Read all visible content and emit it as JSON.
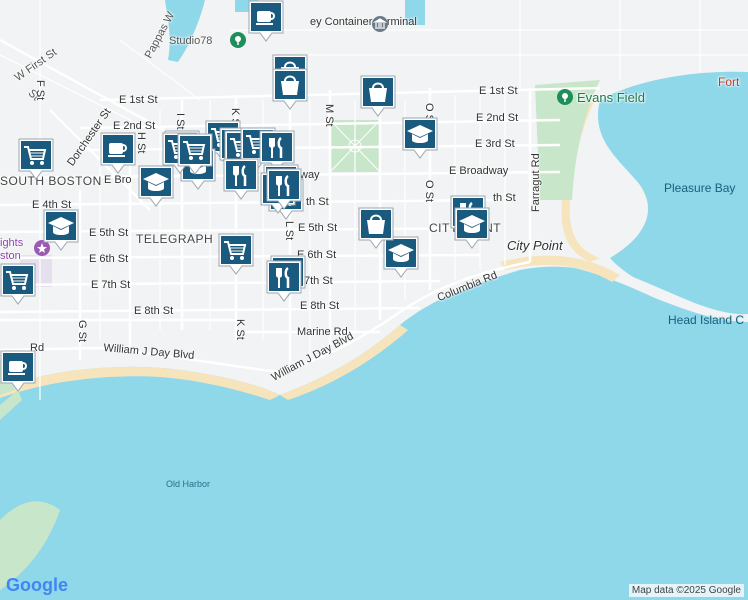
{
  "map": {
    "labels": {
      "w_first_st": "W First St",
      "pappas": "Pappas W",
      "container_terminal": "ey Container Terminal",
      "studio78": "Studio78",
      "fort": "Fort",
      "e_1st_st": "E 1st St",
      "e_1st_st_r": "E 1st St",
      "evans_field": "Evans Field",
      "e_2nd_st": "E 2nd St",
      "e_2nd_st_r": "E 2nd St",
      "e_3rd_st": "E 3rd St",
      "dorchester_st": "Dorchester St",
      "south_boston": "SOUTH BOSTON",
      "e_bro": "E Bro",
      "broadway_mid": "way",
      "e_broadway": "E Broadway",
      "pleasure_bay": "Pleasure Bay",
      "e_4th_st": "E 4th St",
      "th_st_mid": "th St",
      "th_st_r": "th St",
      "e_5th_st": "E 5th St",
      "e_5th_st_mid": "E 5th St",
      "telegraph": "TELEGRAPH",
      "city_point_hood": "CITY POINT",
      "city_point": "City Point",
      "ights": "ights",
      "ston": "ston",
      "e_6th_st": "E 6th St",
      "e_6th_st_mid": "E 6th St",
      "e_7th_st": "E 7th St",
      "th_7_mid": "7th St",
      "e_8th_st": "E 8th St",
      "e_8th_st_mid": "E 8th St",
      "columbia_rd": "Columbia Rd",
      "head_island": "Head Island C",
      "marine_rd": "Marine Rd",
      "william_j_day_1": "William J Day Blvd",
      "william_j_day_2": "William J Day Blvd",
      "rd_left": "Rd",
      "old_harbor": "Old Harbor",
      "m_st": "M St",
      "l_st": "L St",
      "k_st_top": "K St",
      "k_st": "K St",
      "i_st": "I St",
      "h_st": "H St",
      "g_st": "G St",
      "o_st_top": "O St",
      "o_st": "O St",
      "farragut_rd": "Farragut Rd",
      "f_st": "F St",
      "st_top_left": "St"
    },
    "attribution": "Map data ©2025 Google",
    "logo": "Google",
    "colors": {
      "water": "#8ed8ea",
      "land": "#f1f3f4",
      "park": "#c8e6c9",
      "beach": "#f6e4bc",
      "road": "#ffffff",
      "pin_blue": "#1a5a7e",
      "poi_green": "#1e8e5a",
      "poi_grey": "#6b7a86",
      "poi_purple": "#9b59b6"
    },
    "pins": [
      {
        "icon": "coffee-icon"
      },
      {
        "icon": "shopping-bag-icon"
      },
      {
        "icon": "shopping-bag-icon"
      },
      {
        "icon": "shopping-bag-icon"
      },
      {
        "icon": "school-icon"
      },
      {
        "icon": "coffee-icon"
      },
      {
        "icon": "shopping-cart-icon"
      },
      {
        "icon": "coffee-icon"
      },
      {
        "icon": "shopping-cart-icon"
      },
      {
        "icon": "restaurant-icon"
      },
      {
        "icon": "school-icon"
      },
      {
        "icon": "school-icon"
      },
      {
        "icon": "shopping-cart-icon"
      },
      {
        "icon": "shopping-cart-icon"
      },
      {
        "icon": "shopping-cart-icon"
      },
      {
        "icon": "restaurant-icon"
      },
      {
        "icon": "restaurant-icon"
      },
      {
        "icon": "restaurant-icon"
      },
      {
        "icon": "restaurant-icon"
      },
      {
        "icon": "school-icon"
      },
      {
        "icon": "shopping-cart-icon"
      },
      {
        "icon": "restaurant-icon"
      },
      {
        "icon": "restaurant-icon"
      },
      {
        "icon": "restaurant-icon"
      },
      {
        "icon": "school-icon"
      },
      {
        "icon": "shopping-bag-icon"
      },
      {
        "icon": "school-icon"
      },
      {
        "icon": "restaurant-icon"
      },
      {
        "icon": "restaurant-icon"
      },
      {
        "icon": "shopping-cart-icon"
      },
      {
        "icon": "shopping-cart-icon"
      },
      {
        "icon": "coffee-icon"
      }
    ]
  }
}
